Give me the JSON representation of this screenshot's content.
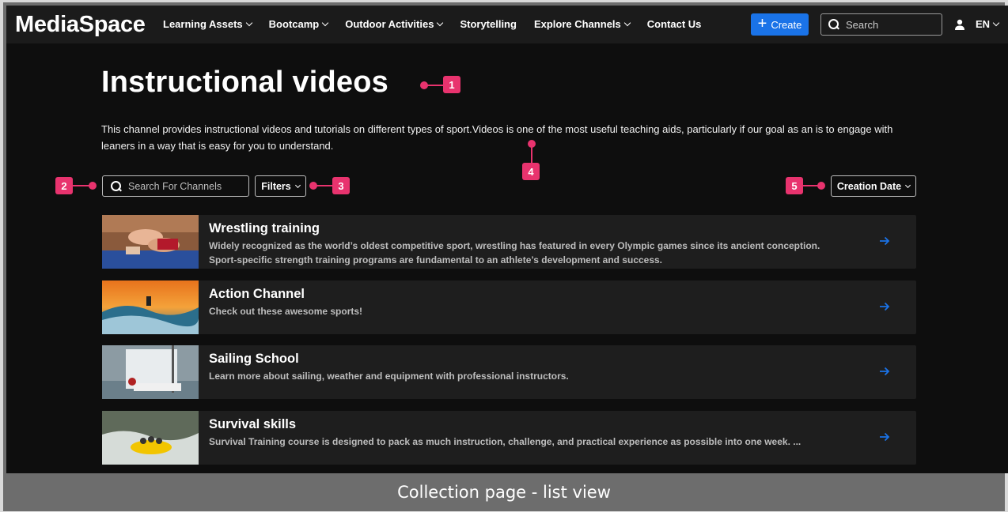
{
  "header": {
    "logo": "MediaSpace",
    "nav": [
      {
        "label": "Learning Assets",
        "dropdown": true
      },
      {
        "label": "Bootcamp",
        "dropdown": true
      },
      {
        "label": "Outdoor Activities",
        "dropdown": true
      },
      {
        "label": "Storytelling",
        "dropdown": false
      },
      {
        "label": "Explore Channels",
        "dropdown": true
      },
      {
        "label": "Contact Us",
        "dropdown": false
      }
    ],
    "create_label": "Create",
    "search_placeholder": "Search",
    "language": "EN",
    "accent_color": "#1a73e8"
  },
  "page": {
    "title": "Instructional videos",
    "description": "This channel provides instructional videos and tutorials on different types of sport.Videos is one of the most useful teaching aids, particularly if our goal as an is to engage with leaners in a way that is easy for you to understand.",
    "search_placeholder": "Search For Channels",
    "filters_label": "Filters",
    "sort_label": "Creation Date"
  },
  "channels": [
    {
      "title": "Wrestling training",
      "description": "Widely recognized as the world’s oldest competitive sport, wrestling has featured in every Olympic games since its ancient conception. Sport-specific strength training programs are fundamental to an athlete’s development and success.",
      "thumb": "wrestling"
    },
    {
      "title": "Action Channel",
      "description": "Check out these awesome sports!",
      "thumb": "surfing"
    },
    {
      "title": "Sailing School",
      "description": "Learn more about sailing, weather and equipment with professional instructors.",
      "thumb": "sailing"
    },
    {
      "title": "Survival skills",
      "description": "Survival Training course is designed to pack as much instruction, challenge, and practical experience as possible into one week. ...",
      "thumb": "rafting"
    }
  ],
  "annotations": [
    "1",
    "2",
    "3",
    "4",
    "5"
  ],
  "annotation_color": "#e8336e",
  "caption": "Collection page - list view"
}
